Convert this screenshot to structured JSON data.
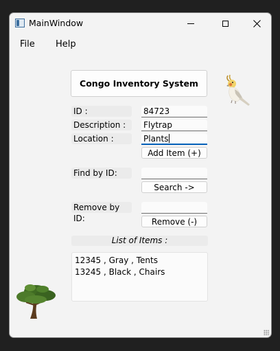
{
  "window": {
    "title": "MainWindow"
  },
  "menu": {
    "file": "File",
    "help": "Help"
  },
  "app_title": "Congo Inventory System",
  "form": {
    "id_label": "ID :",
    "id_value": "84723",
    "description_label": "Description :",
    "description_value": "Flytrap",
    "location_label": "Location :",
    "location_value": "Plants",
    "add_button": "Add Item (+)"
  },
  "find": {
    "label": "Find by ID:",
    "value": "",
    "button": "Search ->"
  },
  "remove": {
    "label": "Remove by ID:",
    "value": "",
    "button": "Remove (-)"
  },
  "list": {
    "header": "List of Items :",
    "items": [
      "12345 , Gray , Tents",
      "13245 , Black , Chairs"
    ]
  },
  "icons": [
    "app-window-icon",
    "minimize-icon",
    "maximize-icon",
    "close-icon",
    "cockatiel-bird-icon",
    "tree-icon",
    "resize-grip-icon"
  ],
  "colors": {
    "window_bg": "#f3f3f3",
    "label_bg": "#ebebeb",
    "desktop": "#202020"
  }
}
